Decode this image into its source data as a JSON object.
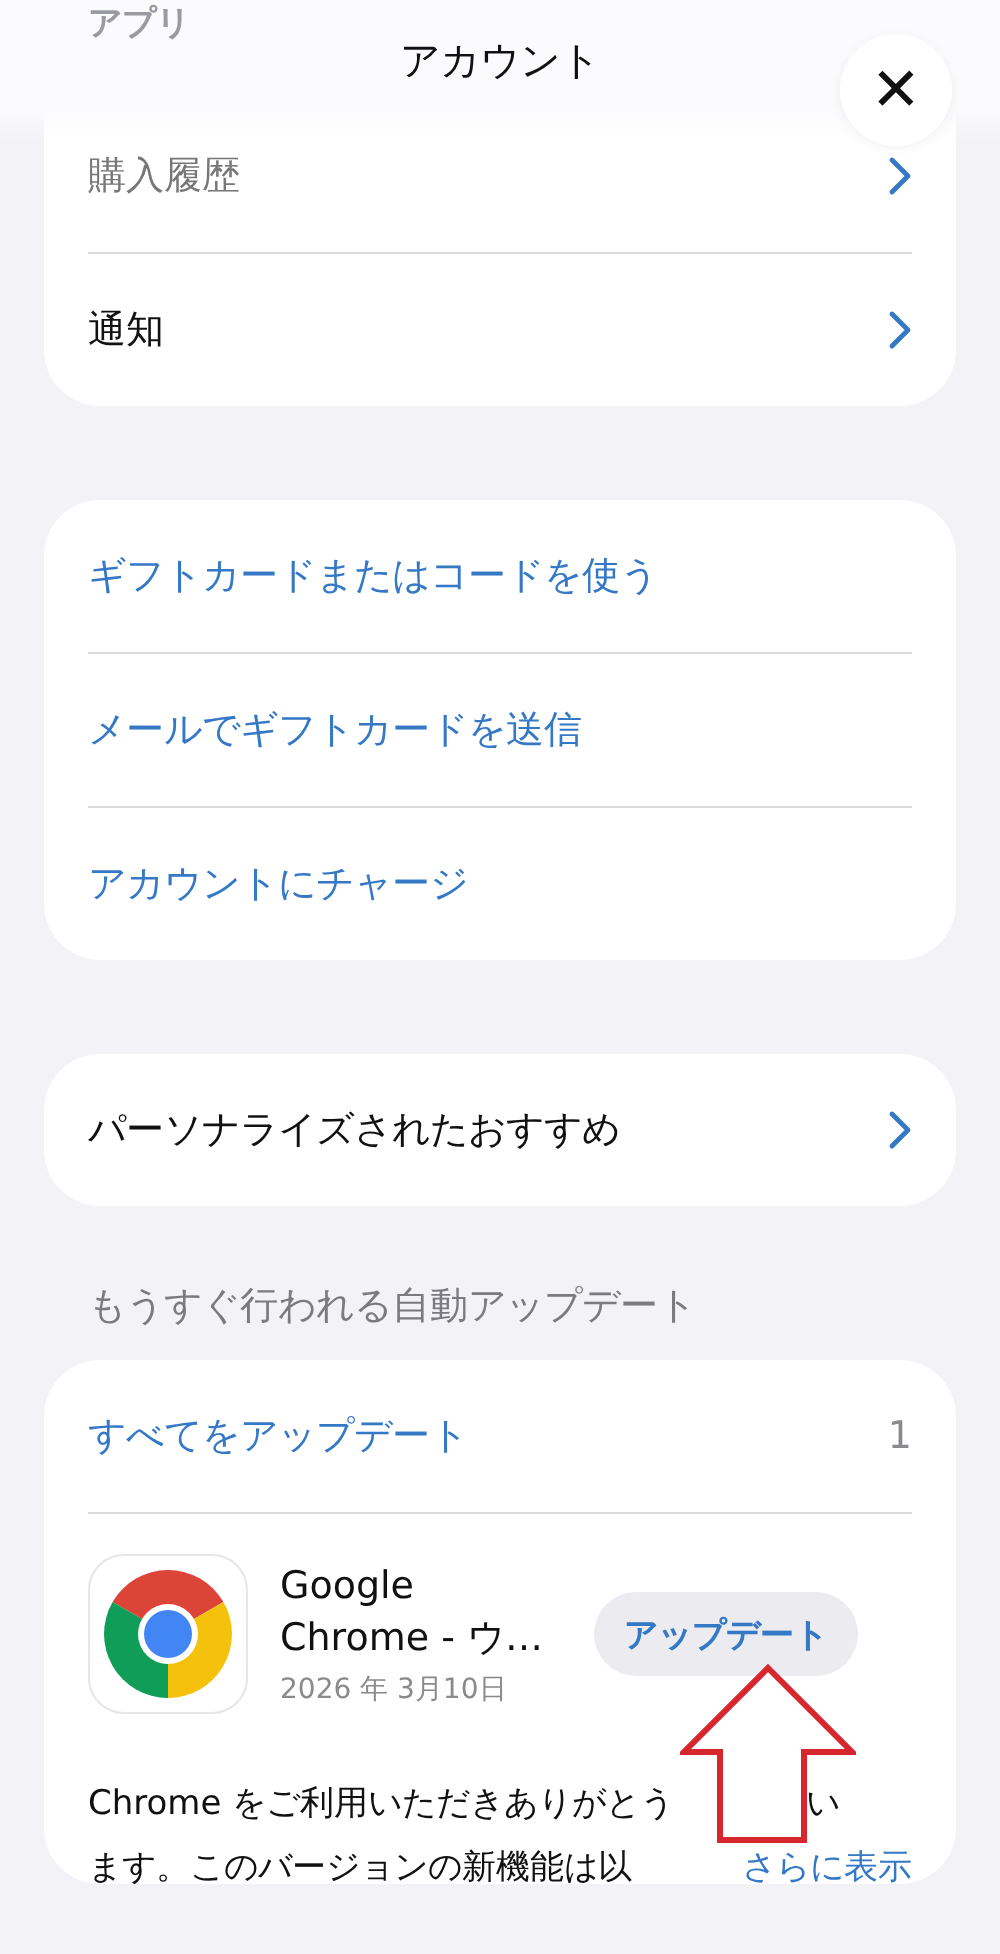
{
  "scrolled_section": {
    "title": "アプリ"
  },
  "header": {
    "title": "アカウント",
    "close_label": "✕"
  },
  "account_list": [
    {
      "label": "購入履歴",
      "faded": true
    },
    {
      "label": "通知",
      "faded": false
    }
  ],
  "gift_actions": [
    {
      "label": "ギフトカードまたはコードを使う"
    },
    {
      "label": "メールでギフトカードを送信"
    },
    {
      "label": "アカウントにチャージ"
    }
  ],
  "recommendations": {
    "label": "パーソナライズされたおすすめ"
  },
  "auto_updates": {
    "heading": "もうすぐ行われる自動アップデート",
    "update_all": "すべてをアップデート",
    "count": "1",
    "apps": [
      {
        "name": "Google Chrome - ウ…",
        "date": "2026 年 3月10日",
        "button": "アップデート",
        "description_line_1": "Chrome をご利用いただきありがとう",
        "description_line_1_tail": "い",
        "description_line_2": "ます。このバージョンの新機能は以",
        "more_link": "さらに表示"
      }
    ]
  },
  "annotation": {
    "kind": "arrow"
  }
}
